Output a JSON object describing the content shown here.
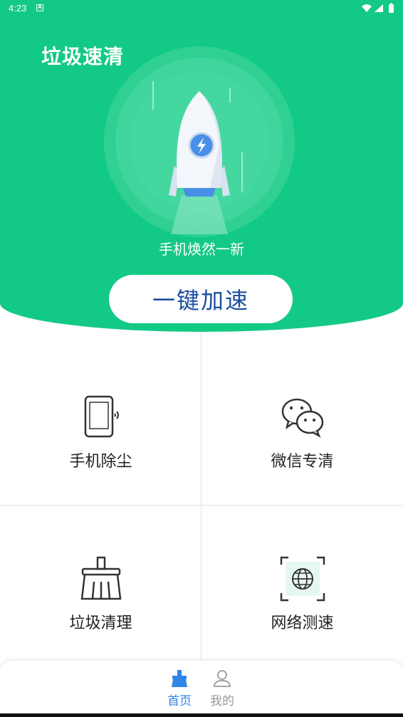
{
  "status_bar": {
    "time": "4:23",
    "notification_icon": "A"
  },
  "header": {
    "title": "垃圾速清"
  },
  "hero": {
    "slogan": "手机焕然一新",
    "action_label": "一键加速"
  },
  "features": [
    {
      "label": "手机除尘",
      "icon": "phone-dust-icon"
    },
    {
      "label": "微信专清",
      "icon": "wechat-icon"
    },
    {
      "label": "垃圾清理",
      "icon": "broom-icon"
    },
    {
      "label": "网络测速",
      "icon": "globe-scan-icon"
    }
  ],
  "nav": [
    {
      "label": "首页",
      "icon": "broom-home-icon",
      "active": true
    },
    {
      "label": "我的",
      "icon": "user-icon",
      "active": false
    }
  ],
  "colors": {
    "brand_green": "#13c986",
    "accent_blue": "#2e86e6",
    "button_text": "#1a4fa0"
  }
}
